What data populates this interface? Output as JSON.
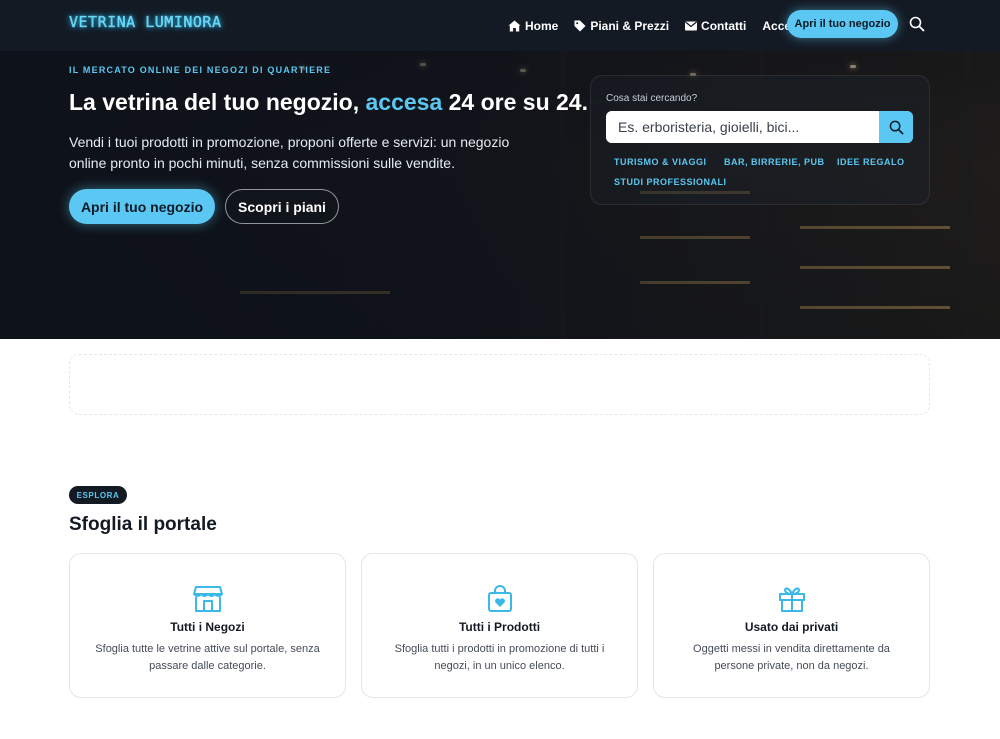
{
  "brand": {
    "logo": "VETRINA LUMINORA",
    "accent_color": "#5ac8f2",
    "dark_color": "#141a24"
  },
  "nav": {
    "items": [
      {
        "label": "Home",
        "icon": "home-icon"
      },
      {
        "label": "Piani & Prezzi",
        "icon": "tag-icon"
      },
      {
        "label": "Contatti",
        "icon": "envelope-icon"
      },
      {
        "label": "Accedi",
        "icon": ""
      }
    ],
    "cta": "Apri il tuo negozio",
    "search_icon": "search-icon"
  },
  "hero": {
    "eyebrow": "IL MERCATO ONLINE DEI NEGOZI DI QUARTIERE",
    "title_before": "La vetrina del tuo negozio, ",
    "title_accent": "accesa",
    "title_after": " 24 ore su 24.",
    "subtitle": "Vendi i tuoi prodotti in promozione, proponi offerte e servizi: un negozio online pronto in pochi minuti, senza commissioni sulle vendite.",
    "primary_button": "Apri il tuo negozio",
    "secondary_button": "Scopri i piani",
    "search": {
      "label": "Cosa stai cercando?",
      "placeholder": "Es. erboristeria, gioielli, bici...",
      "chips": [
        "TURISMO & VIAGGI",
        "BAR, BIRRERIE, PUB",
        "IDEE REGALO",
        "STUDI PROFESSIONALI"
      ]
    }
  },
  "section": {
    "pill": "ESPLORA",
    "title": "Sfoglia il portale",
    "cards": [
      {
        "icon": "storefront-icon",
        "title": "Tutti i Negozi",
        "desc": "Sfoglia tutte le vetrine attive sul portale, senza passare dalle categorie."
      },
      {
        "icon": "shopping-bag-heart-icon",
        "title": "Tutti i Prodotti",
        "desc": "Sfoglia tutti i prodotti in promozione di tutti i negozi, in un unico elenco."
      },
      {
        "icon": "gift-icon",
        "title": "Usato dai privati",
        "desc": "Oggetti messi in vendita direttamente da persone private, non da negozi."
      }
    ]
  }
}
